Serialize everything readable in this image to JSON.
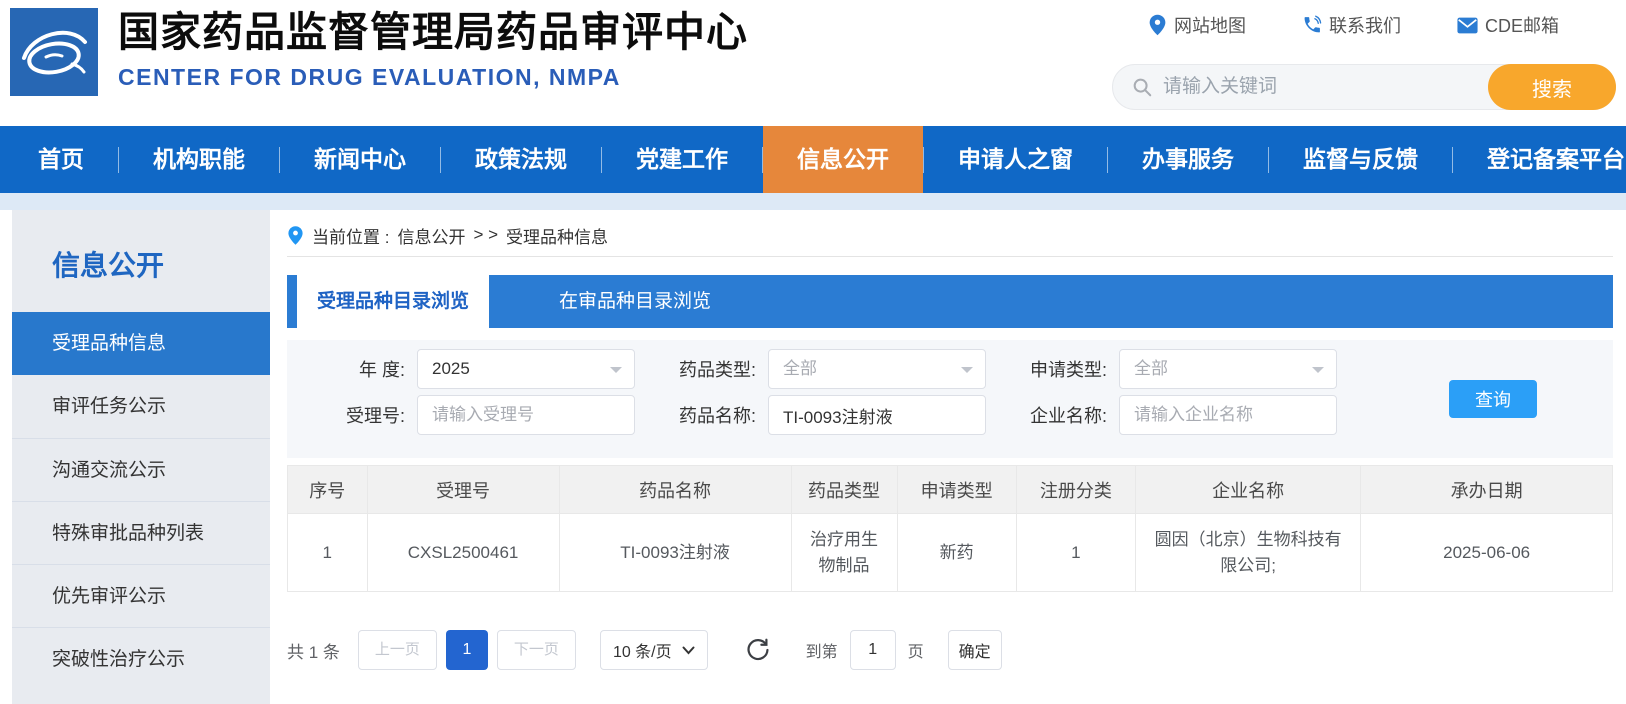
{
  "header": {
    "title": "国家药品监督管理局药品审评中心",
    "subtitle": "CENTER FOR DRUG EVALUATION, NMPA",
    "quick_links": [
      {
        "label": "网站地图",
        "icon": "location-pin-icon"
      },
      {
        "label": "联系我们",
        "icon": "phone-icon"
      },
      {
        "label": "CDE邮箱",
        "icon": "mail-icon"
      }
    ],
    "search": {
      "placeholder": "请输入关键词",
      "button_label": "搜索",
      "icon": "search-icon"
    }
  },
  "nav": {
    "items": [
      {
        "label": "首页",
        "active": false
      },
      {
        "label": "机构职能",
        "active": false
      },
      {
        "label": "新闻中心",
        "active": false
      },
      {
        "label": "政策法规",
        "active": false
      },
      {
        "label": "党建工作",
        "active": false
      },
      {
        "label": "信息公开",
        "active": true
      },
      {
        "label": "申请人之窗",
        "active": false
      },
      {
        "label": "办事服务",
        "active": false
      },
      {
        "label": "监督与反馈",
        "active": false
      },
      {
        "label": "登记备案平台",
        "active": false
      }
    ]
  },
  "sidebar": {
    "title": "信息公开",
    "items": [
      {
        "label": "受理品种信息",
        "active": true
      },
      {
        "label": "审评任务公示",
        "active": false
      },
      {
        "label": "沟通交流公示",
        "active": false
      },
      {
        "label": "特殊审批品种列表",
        "active": false
      },
      {
        "label": "优先审评公示",
        "active": false
      },
      {
        "label": "突破性治疗公示",
        "active": false
      }
    ]
  },
  "breadcrumb": {
    "prefix": "当前位置 :",
    "crumb1": "信息公开",
    "separator": "> >",
    "crumb2": "受理品种信息"
  },
  "tabs": [
    {
      "label": "受理品种目录浏览",
      "active": true
    },
    {
      "label": "在审品种目录浏览",
      "active": false
    }
  ],
  "filters": {
    "year": {
      "label": "年 度:",
      "value": "2025"
    },
    "drug_type": {
      "label": "药品类型:",
      "value": "全部"
    },
    "apply_type": {
      "label": "申请类型:",
      "value": "全部"
    },
    "acceptance_no": {
      "label": "受理号:",
      "placeholder": "请输入受理号"
    },
    "drug_name": {
      "label": "药品名称:",
      "value": "TI-0093注射液"
    },
    "company": {
      "label": "企业名称:",
      "placeholder": "请输入企业名称"
    },
    "query_button": "查询"
  },
  "table": {
    "columns": [
      "序号",
      "受理号",
      "药品名称",
      "药品类型",
      "申请类型",
      "注册分类",
      "企业名称",
      "承办日期"
    ],
    "rows": [
      [
        "1",
        "CXSL2500461",
        "TI-0093注射液",
        "治疗用生物制品",
        "新药",
        "1",
        "圆因（北京）生物科技有限公司;",
        "2025-06-06"
      ]
    ]
  },
  "pagination": {
    "total": "共 1 条",
    "prev": "上一页",
    "current_page": "1",
    "next": "下一页",
    "page_size": "10 条/页",
    "goto_label": "到第",
    "goto_value": "1",
    "goto_unit": "页",
    "confirm": "确定"
  },
  "colors": {
    "nav_blue": "#1068c6",
    "active_orange": "#e6873b",
    "tab_blue": "#2b7cd3",
    "sidebar_active_blue": "#2878cc",
    "search_orange": "#f8a72c",
    "query_blue": "#2b9ff7",
    "page_active_blue": "#2365d0"
  }
}
